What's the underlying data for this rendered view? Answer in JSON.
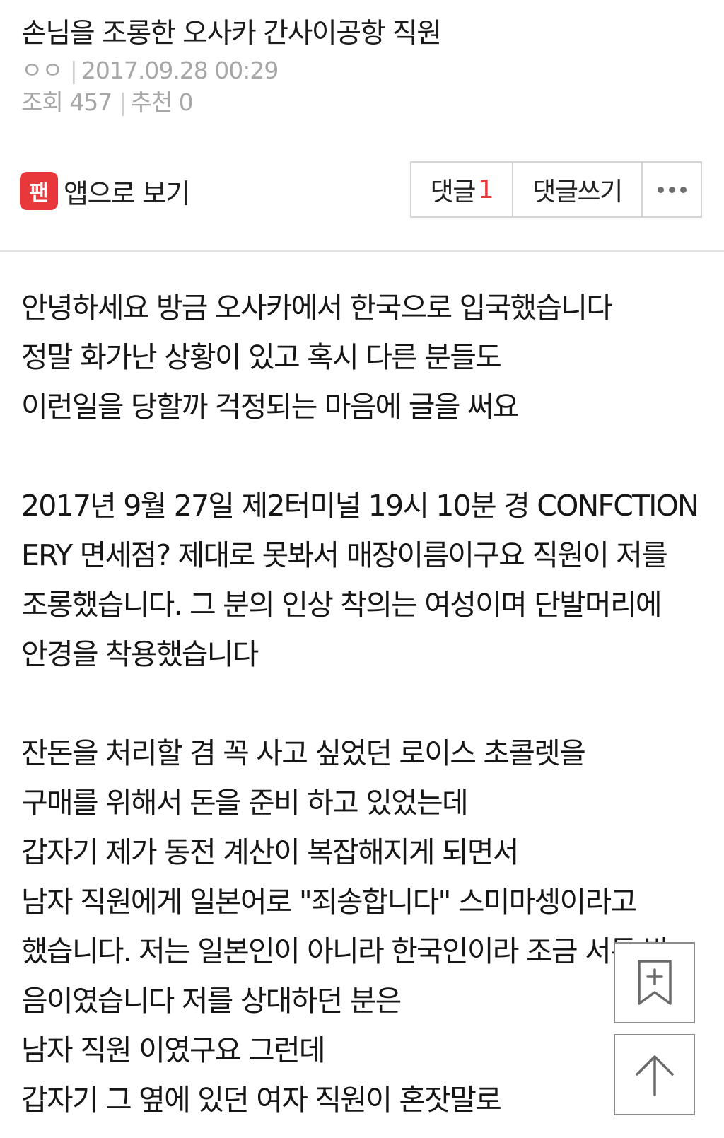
{
  "post": {
    "title": "손님을 조롱한 오사카 간사이공항 직원",
    "author": "ㅇㅇ",
    "date": "2017.09.28 00:29",
    "views_label": "조회",
    "views": "457",
    "recommend_label": "추천",
    "recommend": "0"
  },
  "toolbar": {
    "app_logo_text": "팬",
    "app_view_label": "앱으로 보기",
    "comments_label": "댓글",
    "comments_count": "1",
    "write_comment_label": "댓글쓰기",
    "more_icon": "more-dots-icon"
  },
  "content": {
    "paragraphs": [
      [
        "안녕하세요 방금 오사카에서 한국으로 입국했습니다",
        "정말 화가난 상황이 있고 혹시 다른 분들도",
        "이런일을 당할까 걱정되는 마음에 글을 써요"
      ],
      [
        "2017년 9월 27일 제2터미널 19시 10분 경  CONFCTION",
        "ERY 면세점? 제대로 못봐서 매장이름이구요 직원이 저를",
        "조롱했습니다. 그 분의 인상 착의는 여성이며 단발머리에",
        "안경을 착용했습니다"
      ],
      [
        "잔돈을 처리할 겸 꼭 사고 싶었던 로이스 초콜렛을",
        "구매를 위해서 돈을 준비 하고 있었는데",
        "갑자기 제가 동전 계산이 복잡해지게 되면서",
        "남자 직원에게 일본어로 \"죄송합니다\" 스미마셍이라고",
        "했습니다. 저는 일본인이 아니라 한국인이라 조금 서툰 발",
        "음이였습니다 저를 상대하던 분은",
        "남자 직원 이였구요 그런데",
        "갑자기 그 옆에 있던 여자 직원이 혼잣말로"
      ]
    ]
  },
  "floating": {
    "bookmark_icon": "bookmark-add-icon",
    "scroll_top_icon": "arrow-up-icon"
  }
}
